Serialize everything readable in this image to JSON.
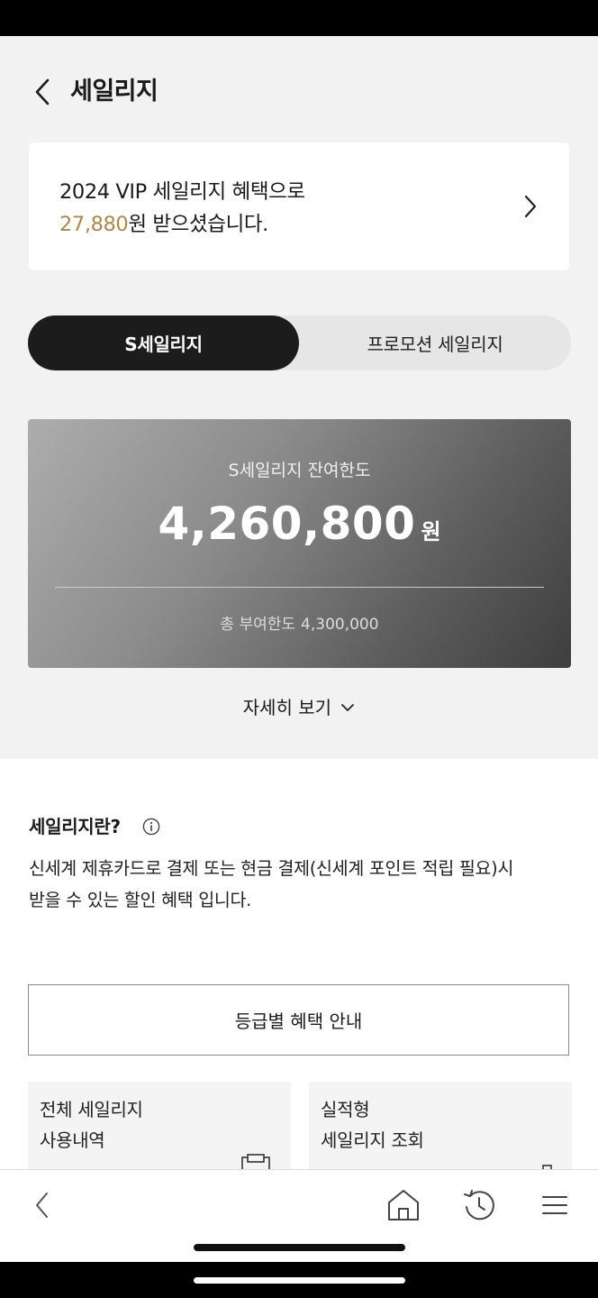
{
  "header": {
    "title": "세일리지"
  },
  "vip_banner": {
    "line1": "2024 VIP 세일리지 혜택으로",
    "amount": "27,880",
    "line2_suffix": "원 받으셨습니다.",
    "accent_color": "#a88a4f"
  },
  "tabs": {
    "active": "S세일리지",
    "inactive": "프로모션 세일리지"
  },
  "balance": {
    "label": "S세일리지 잔여한도",
    "amount": "4,260,800",
    "unit": "원",
    "total_label": "총 부여한도",
    "total_value": "4,300,000"
  },
  "detail_toggle": {
    "label": "자세히 보기"
  },
  "info": {
    "title": "세일리지란?",
    "description": "신세계 제휴카드로 결제 또는 현금 결제(신세계 포인트 적립 필요)시 받을 수 있는 할인 혜택 입니다."
  },
  "grade_button": {
    "label": "등급별 혜택 안내"
  },
  "tiles": {
    "history": {
      "line1": "전체 세일리지",
      "line2": "사용내역",
      "icon": "receipt-icon"
    },
    "performance": {
      "line1": "실적형",
      "line2": "세일리지 조회",
      "icon": "search-icon"
    }
  },
  "bottom_nav": {
    "icons": [
      "back-icon",
      "home-icon",
      "recent-history-icon",
      "menu-icon"
    ]
  },
  "colors": {
    "background": "#f2f2f2",
    "dark": "#1c1c1c",
    "accent_gold": "#a88a4f"
  }
}
